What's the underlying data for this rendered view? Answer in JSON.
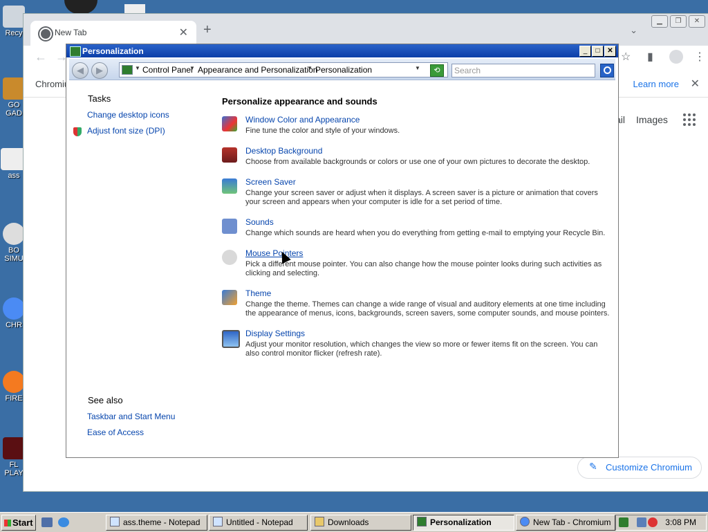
{
  "desktop": {
    "icons": [
      {
        "label": "Recy"
      },
      {
        "label": "GO\nGAD"
      },
      {
        "label": "ass"
      },
      {
        "label": "BO\nSIMU"
      },
      {
        "label": "CHR"
      },
      {
        "label": "FIRE"
      },
      {
        "label": "FL\nPLAY"
      }
    ]
  },
  "chromium": {
    "tab_title": "New Tab",
    "bookmark_left": "Chromiu",
    "learn_more": "Learn more",
    "gmail_fragment": "ail",
    "images_link": "Images",
    "customize_label": "Customize Chromium"
  },
  "window": {
    "title": "Personalization",
    "breadcrumb": [
      "Control Panel",
      "Appearance and Personalization",
      "Personalization"
    ],
    "search_placeholder": "Search",
    "tasks_heading": "Tasks",
    "tasks": [
      "Change desktop icons",
      "Adjust font size (DPI)"
    ],
    "see_also_heading": "See also",
    "see_also": [
      "Taskbar and Start Menu",
      "Ease of Access"
    ],
    "main_heading": "Personalize appearance and sounds",
    "items": [
      {
        "name": "Window Color and Appearance",
        "desc": "Fine tune the color and style of your windows.",
        "icon": "window-color-icon"
      },
      {
        "name": "Desktop Background",
        "desc": "Choose from available backgrounds or colors or use one of your own pictures to decorate the desktop.",
        "icon": "desktop-background-icon"
      },
      {
        "name": "Screen Saver",
        "desc": "Change your screen saver or adjust when it displays. A screen saver is a picture or animation that covers your screen and appears when your computer is idle for a set period of time.",
        "icon": "screen-saver-icon"
      },
      {
        "name": "Sounds",
        "desc": "Change which sounds are heard when you do everything from getting e-mail to emptying your Recycle Bin.",
        "icon": "sounds-icon"
      },
      {
        "name": "Mouse Pointers",
        "desc": "Pick a different mouse pointer. You can also change how the mouse pointer looks during such activities as clicking and selecting.",
        "icon": "mouse-icon"
      },
      {
        "name": "Theme",
        "desc": "Change the theme. Themes can change a wide range of visual and auditory elements at one time including the appearance of menus, icons, backgrounds, screen savers, some computer sounds, and mouse pointers.",
        "icon": "theme-icon"
      },
      {
        "name": "Display Settings",
        "desc": "Adjust your monitor resolution, which changes the view so more or fewer items fit on the screen. You can also control monitor flicker (refresh rate).",
        "icon": "display-icon"
      }
    ]
  },
  "taskbar": {
    "start_label": "Start",
    "buttons": [
      {
        "label": "ass.theme - Notepad"
      },
      {
        "label": "Untitled - Notepad"
      },
      {
        "label": "Downloads"
      },
      {
        "label": "Personalization",
        "active": true
      },
      {
        "label": "New Tab - Chromium"
      }
    ],
    "clock": "3:08 PM"
  }
}
